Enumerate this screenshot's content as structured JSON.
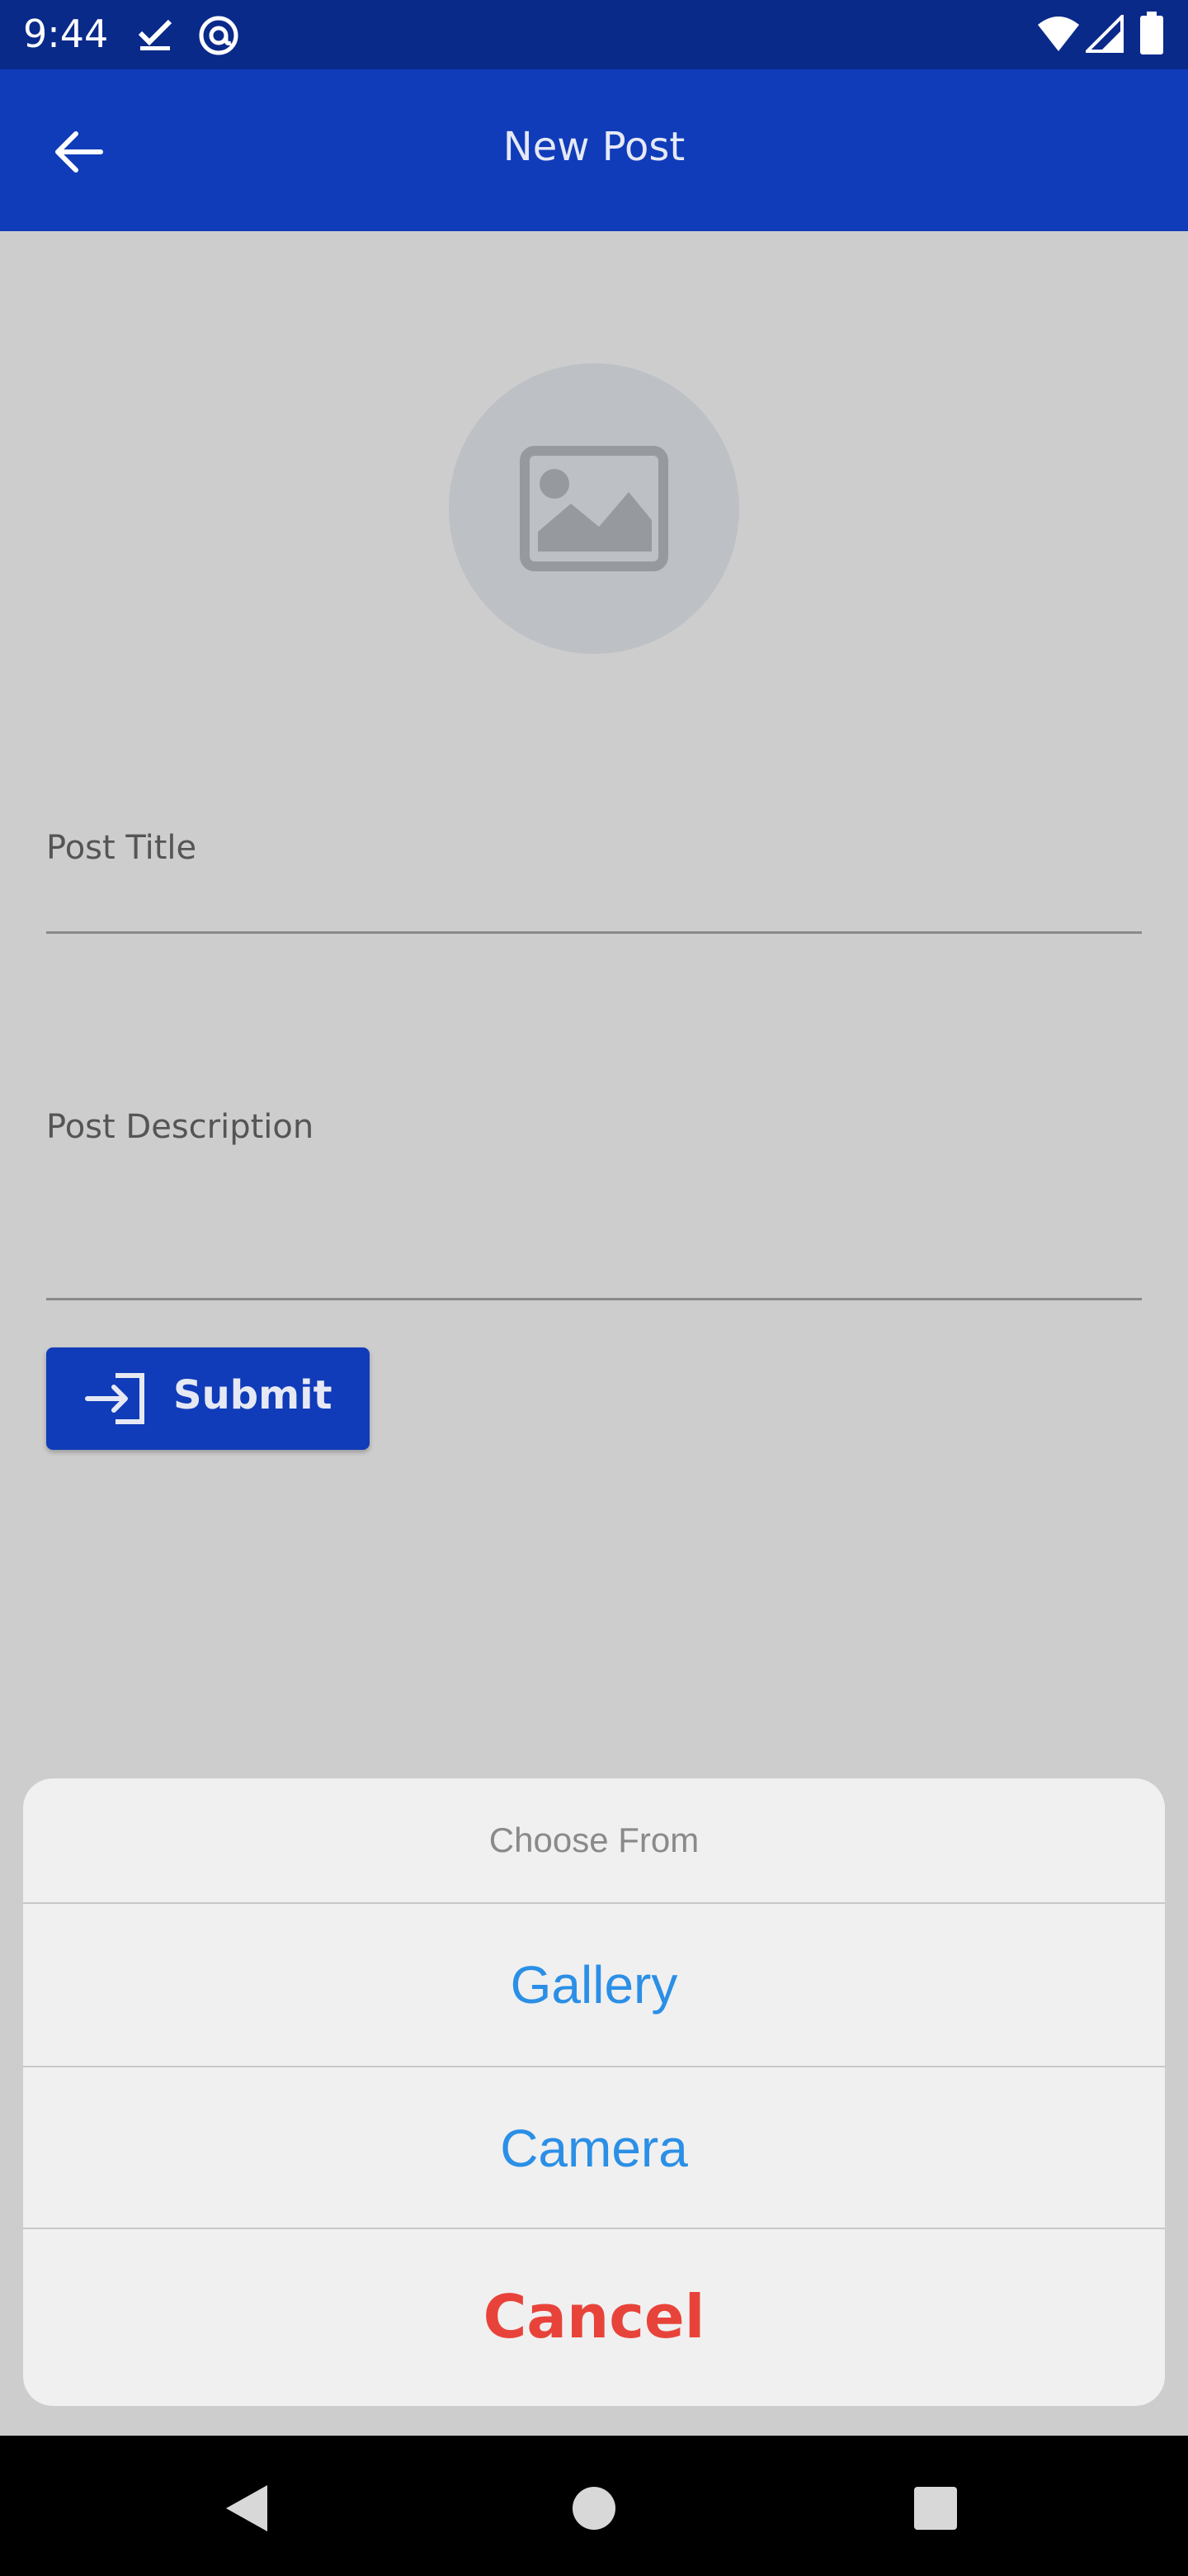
{
  "status_bar": {
    "time": "9:44",
    "icons": [
      "check-icon",
      "at-icon",
      "wifi-icon",
      "signal-icon",
      "battery-icon"
    ]
  },
  "app_bar": {
    "title": "New Post",
    "back_icon": "arrow-left-icon"
  },
  "form": {
    "image_placeholder_icon": "image-icon",
    "post_title_label": "Post Title",
    "post_title_value": "",
    "post_description_label": "Post Description",
    "post_description_value": "",
    "submit_label": "Submit",
    "submit_icon": "login-icon"
  },
  "action_sheet": {
    "title": "Choose From",
    "options": [
      {
        "label": "Gallery"
      },
      {
        "label": "Camera"
      }
    ],
    "cancel_label": "Cancel"
  },
  "nav_bar": {
    "icons": [
      "back-triangle-icon",
      "home-circle-icon",
      "recents-square-icon"
    ]
  },
  "colors": {
    "status_bar": "#0a2a8a",
    "primary": "#103cb9",
    "background": "#cdcdcd",
    "sheet": "#f0f0f0",
    "option_text": "#2b8fe6",
    "cancel_text": "#e8433a"
  }
}
